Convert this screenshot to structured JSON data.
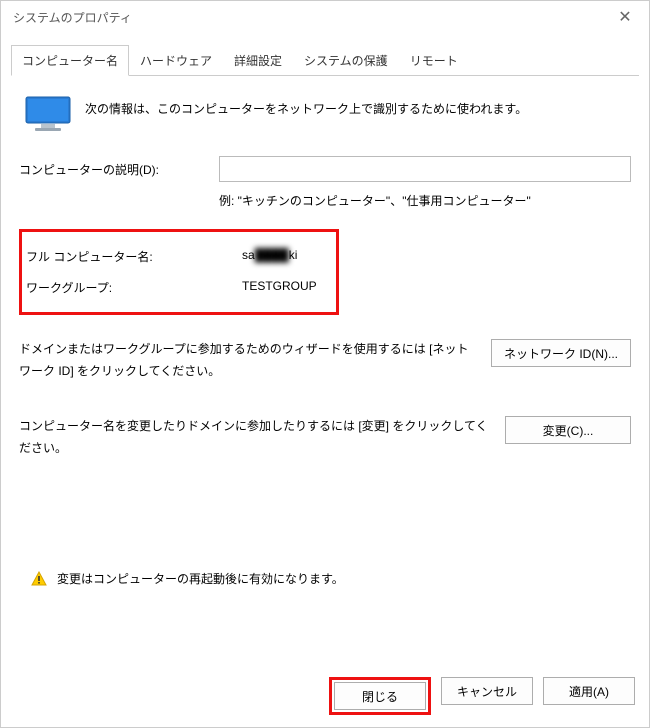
{
  "window": {
    "title": "システムのプロパティ"
  },
  "tabs": {
    "t0": "コンピューター名",
    "t1": "ハードウェア",
    "t2": "詳細設定",
    "t3": "システムの保護",
    "t4": "リモート"
  },
  "info_text": "次の情報は、このコンピューターをネットワーク上で識別するために使われます。",
  "desc_label": "コンピューターの説明(D):",
  "desc_value": "",
  "example_text": "例: \"キッチンのコンピューター\"、\"仕事用コンピューター\"",
  "computer_name": {
    "label": "フル コンピューター名:",
    "prefix": "sa",
    "mask": "████",
    "suffix": "ki"
  },
  "workgroup": {
    "label": "ワークグループ:",
    "value": "TESTGROUP"
  },
  "netid": {
    "text": "ドメインまたはワークグループに参加するためのウィザードを使用するには [ネットワーク ID] をクリックしてください。",
    "button": "ネットワーク ID(N)..."
  },
  "change": {
    "text": "コンピューター名を変更したりドメインに参加したりするには [変更] をクリックしてください。",
    "button": "変更(C)..."
  },
  "restart_note": "変更はコンピューターの再起動後に有効になります。",
  "buttons": {
    "close": "閉じる",
    "cancel": "キャンセル",
    "apply": "適用(A)"
  }
}
